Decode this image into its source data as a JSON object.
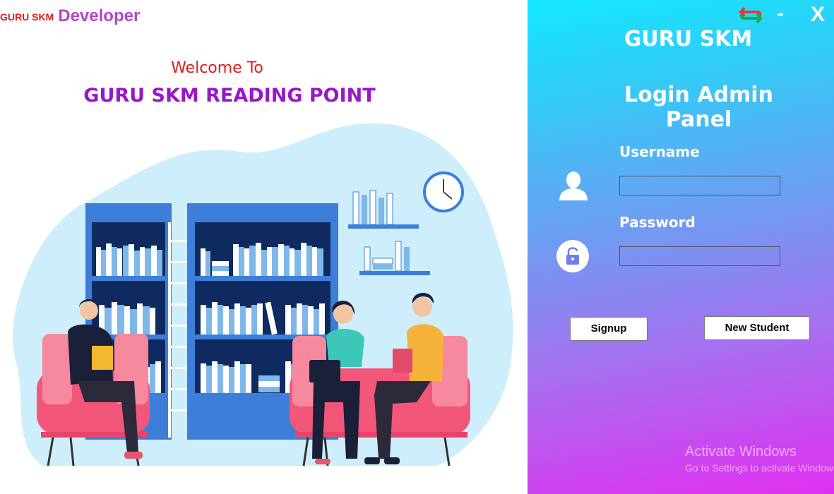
{
  "brand": {
    "small": "GURU SKM",
    "big": "Developer"
  },
  "left": {
    "welcome": "Welcome To",
    "title": "GURU SKM READING POINT"
  },
  "titlebar": {
    "swap_icon": "swap-arrows-icon",
    "minimize": "-",
    "close": "X"
  },
  "right": {
    "app_name": "GURU SKM",
    "panel_title": "Login Admin Panel",
    "username_label": "Username",
    "username_value": "",
    "password_label": "Password",
    "password_value": "",
    "user_icon": "user-icon",
    "lock_icon": "lock-icon",
    "signup_label": "Signup",
    "new_student_label": "New Student"
  },
  "watermark": {
    "line1": "Activate Windows",
    "line2": "Go to Settings to activate Windows."
  },
  "colors": {
    "brand_red": "#e01b1b",
    "brand_purple": "#b545c9",
    "title_purple": "#9a16c9",
    "gradient_top": "#14e8ff",
    "gradient_bottom": "#e12ff0"
  }
}
